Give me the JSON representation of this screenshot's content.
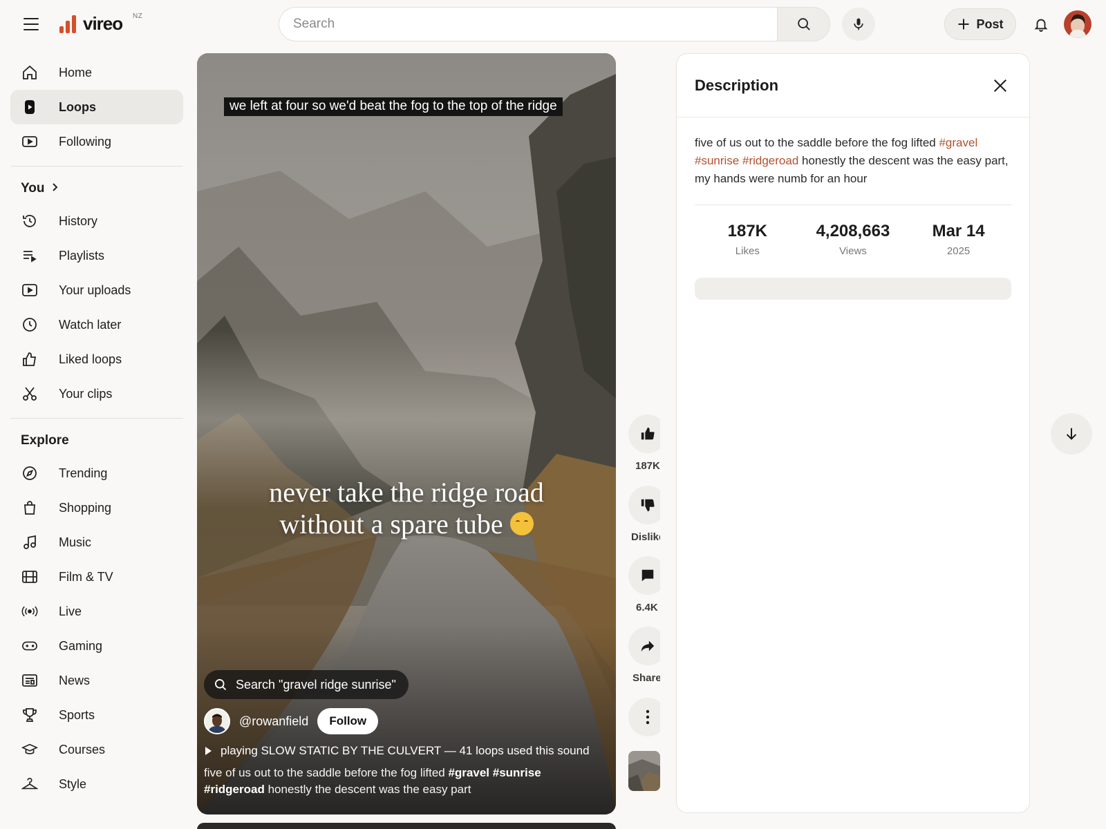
{
  "header": {
    "app_name": "vireo",
    "region": "NZ",
    "search_placeholder": "Search",
    "post_label": "Post",
    "icons": [
      "menu-icon",
      "search-icon",
      "mic-icon",
      "plus-icon",
      "bell-icon"
    ]
  },
  "sidebar": {
    "main": [
      {
        "label": "Home",
        "icon": "home-icon"
      },
      {
        "label": "Loops",
        "icon": "loops-icon",
        "active": true
      },
      {
        "label": "Following",
        "icon": "following-icon"
      }
    ],
    "you_heading": "You",
    "you": [
      {
        "label": "History",
        "icon": "history-icon"
      },
      {
        "label": "Playlists",
        "icon": "playlists-icon"
      },
      {
        "label": "Your uploads",
        "icon": "uploads-icon"
      },
      {
        "label": "Watch later",
        "icon": "clock-icon"
      },
      {
        "label": "Liked loops",
        "icon": "thumbs-up-icon"
      },
      {
        "label": "Your clips",
        "icon": "scissors-icon"
      }
    ],
    "explore_heading": "Explore",
    "explore": [
      {
        "label": "Trending",
        "icon": "compass-icon"
      },
      {
        "label": "Shopping",
        "icon": "bag-icon"
      },
      {
        "label": "Music",
        "icon": "music-icon"
      },
      {
        "label": "Film & TV",
        "icon": "film-icon"
      },
      {
        "label": "Live",
        "icon": "live-icon"
      },
      {
        "label": "Gaming",
        "icon": "gamepad-icon"
      },
      {
        "label": "News",
        "icon": "news-icon"
      },
      {
        "label": "Sports",
        "icon": "trophy-icon"
      },
      {
        "label": "Courses",
        "icon": "graduation-cap-icon"
      },
      {
        "label": "Style",
        "icon": "hanger-icon"
      }
    ]
  },
  "video": {
    "caption_top": "we left at four so we'd beat the fog to the top of the ridge",
    "caption_line1": "never take the ridge road",
    "caption_line2": "without a spare tube",
    "search_chip": "Search \"gravel ridge sunrise\"",
    "creator_handle": "@rowanfield",
    "follow_label": "Follow",
    "sound": "playing SLOW STATIC BY THE CULVERT — 41 loops used this sound",
    "desc_prefix": "five of us out to the saddle before the fog lifted ",
    "desc_tag1": "#gravel",
    "desc_tag2": "#sunrise",
    "desc_tag3": "#ridgeroad",
    "desc_suffix": " honestly the descent was the easy part"
  },
  "actions": {
    "like_count": "187K",
    "dislike_label": "Dislike",
    "comment_count": "6.4K",
    "share_label": "Share"
  },
  "panel": {
    "title": "Description",
    "text_prefix": "five of us out to the saddle before the fog lifted ",
    "tag1": "#gravel",
    "tag2": "#sunrise",
    "tag3": "#ridgeroad",
    "text_suffix": " honestly the descent was the easy part, my hands were numb for an hour",
    "stats": [
      {
        "value": "187K",
        "label": "Likes"
      },
      {
        "value": "4,208,663",
        "label": "Views"
      },
      {
        "value": "Mar 14",
        "label": "2025"
      }
    ]
  },
  "colors": {
    "accent": "#d4502b",
    "hashtag": "#b3502e",
    "background": "#f9f8f6"
  }
}
